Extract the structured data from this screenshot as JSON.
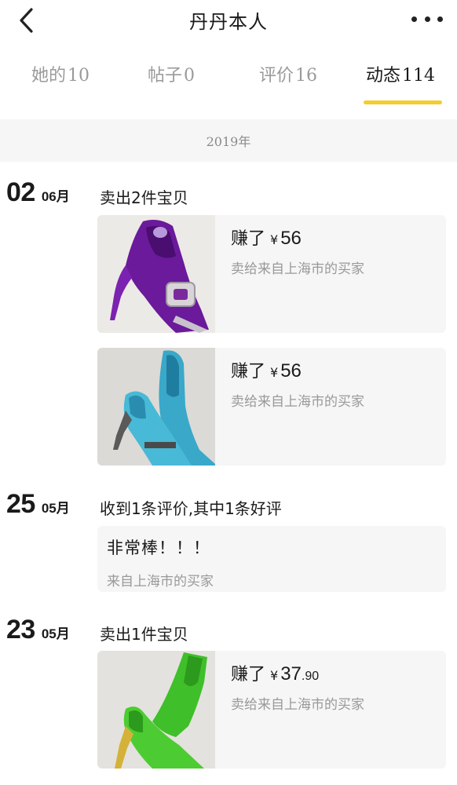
{
  "header": {
    "title": "丹丹本人"
  },
  "tabs": [
    {
      "label": "她的",
      "count": "10",
      "active": false
    },
    {
      "label": "帖子",
      "count": "0",
      "active": false
    },
    {
      "label": "评价",
      "count": "16",
      "active": false
    },
    {
      "label": "动态",
      "count": "114",
      "active": true
    }
  ],
  "year": "2019年",
  "entries": [
    {
      "day": "02",
      "month": "06月",
      "title": "卖出2件宝贝",
      "items": [
        {
          "earned_label": "赚了",
          "currency": "¥",
          "amount": "56",
          "decimals": "",
          "buyer": "卖给来自上海市的买家",
          "image": "purple-shoe"
        },
        {
          "earned_label": "赚了",
          "currency": "¥",
          "amount": "56",
          "decimals": "",
          "buyer": "卖给来自上海市的买家",
          "image": "blue-shoe"
        }
      ]
    },
    {
      "day": "25",
      "month": "05月",
      "title": "收到1条评价,其中1条好评",
      "review": {
        "text": "非常棒！！！",
        "from": "来自上海市的买家"
      }
    },
    {
      "day": "23",
      "month": "05月",
      "title": "卖出1件宝贝",
      "items": [
        {
          "earned_label": "赚了",
          "currency": "¥",
          "amount": "37",
          "decimals": ".90",
          "buyer": "卖给来自上海市的买家",
          "image": "green-shoe"
        }
      ]
    }
  ],
  "colors": {
    "accent": "#f5cc2c",
    "tab_inactive": "#9a9a9a",
    "card_bg": "#f6f6f6"
  }
}
